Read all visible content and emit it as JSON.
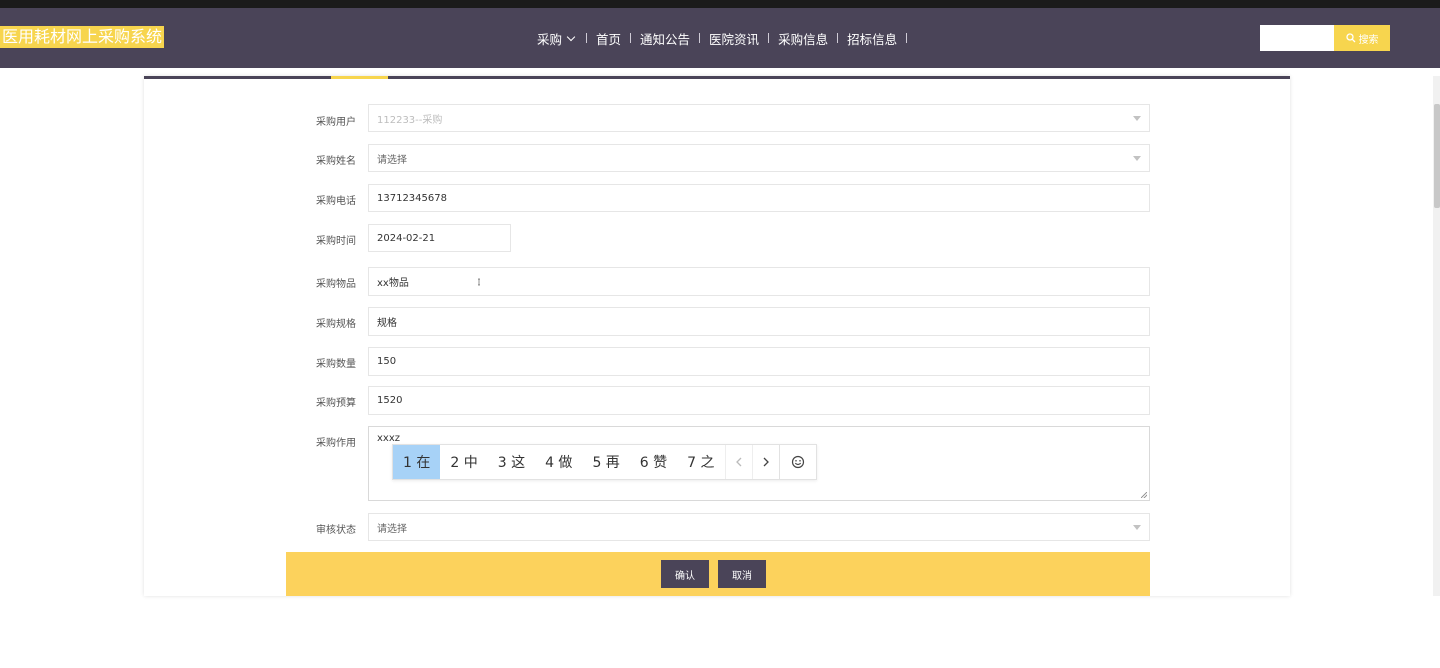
{
  "header": {
    "brand": "医用耗材网上采购系统",
    "nav": [
      {
        "label": "采购",
        "dropdown": true
      },
      {
        "label": "首页"
      },
      {
        "label": "通知公告"
      },
      {
        "label": "医院资讯"
      },
      {
        "label": "采购信息"
      },
      {
        "label": "招标信息"
      }
    ],
    "search_placeholder": "",
    "search_label": "搜索"
  },
  "form": {
    "fields": [
      {
        "label": "采购用户",
        "value": "112233--采购",
        "type": "select",
        "disabled": true
      },
      {
        "label": "采购姓名",
        "value": "请选择",
        "type": "select"
      },
      {
        "label": "采购电话",
        "value": "13712345678",
        "type": "text"
      },
      {
        "label": "采购时间",
        "value": "2024-02-21",
        "type": "date"
      },
      {
        "label": "采购物品",
        "value": "xx物品",
        "type": "text"
      },
      {
        "label": "采购规格",
        "value": "规格",
        "type": "text"
      },
      {
        "label": "采购数量",
        "value": "150",
        "type": "text"
      },
      {
        "label": "采购预算",
        "value": "1520",
        "type": "text"
      },
      {
        "label": "采购作用",
        "value": "xxxz",
        "type": "textarea"
      },
      {
        "label": "审核状态",
        "value": "请选择",
        "type": "select"
      }
    ],
    "confirm_label": "确认",
    "cancel_label": "取消"
  },
  "ime": {
    "candidates": [
      "1 在",
      "2 中",
      "3 这",
      "4 做",
      "5 再",
      "6 赞",
      "7 之"
    ],
    "selected_index": 0
  },
  "colors": {
    "header_bg": "#4a4458",
    "accent": "#f7d54e",
    "action_bar": "#fcd25c",
    "ime_selected": "#a7d2f7"
  }
}
